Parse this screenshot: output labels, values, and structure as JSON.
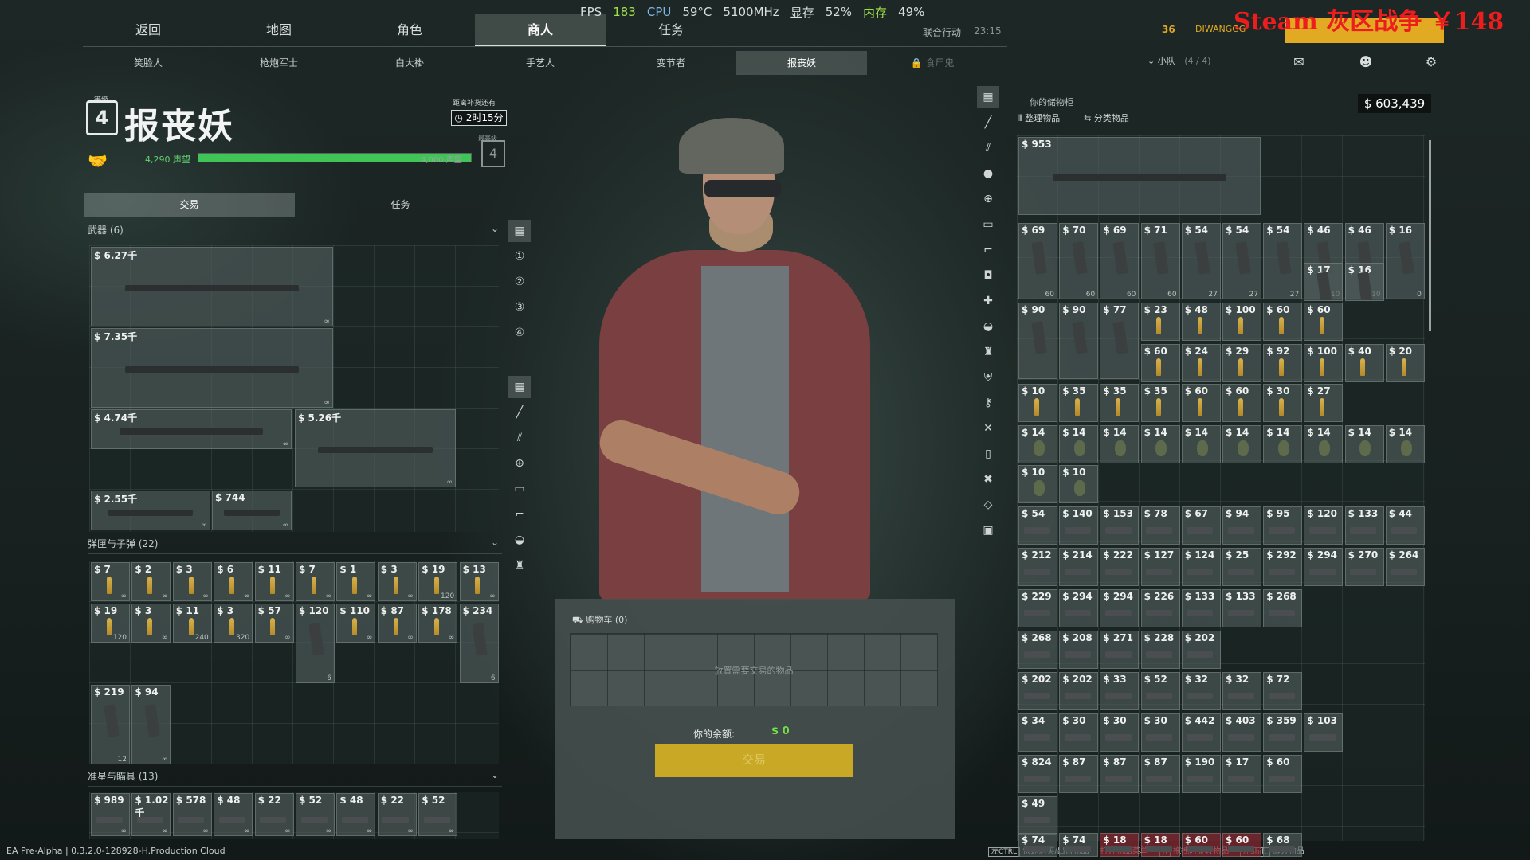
{
  "perf": {
    "fps_label": "FPS",
    "fps": "183",
    "cpu_label": "CPU",
    "cpu_temp": "59°C",
    "cpu_freq": "5100MHz",
    "vram_label": "显存",
    "vram": "52%",
    "ram_label": "内存",
    "ram": "49%"
  },
  "overlay": {
    "steam": "Steam  灰区战争 ￥148",
    "coop": "联合行动",
    "clock": "23:15"
  },
  "player": {
    "level": "36",
    "name": "DIWANGGG"
  },
  "top_nav": [
    {
      "label": "返回"
    },
    {
      "label": "地图"
    },
    {
      "label": "角色"
    },
    {
      "label": "商人",
      "active": true
    },
    {
      "label": "任务"
    }
  ],
  "sub_nav": [
    {
      "label": "笑脸人"
    },
    {
      "label": "枪炮军士"
    },
    {
      "label": "白大褂"
    },
    {
      "label": "手艺人"
    },
    {
      "label": "变节者"
    },
    {
      "label": "报丧妖",
      "active": true
    },
    {
      "label": "食尸鬼",
      "locked": true
    }
  ],
  "squad": {
    "label": "小队",
    "count": "(4 / 4)"
  },
  "trader": {
    "level_label": "等级",
    "level": "4",
    "name": "报丧妖",
    "restock_label": "距离补货还有",
    "restock_time": "2时15分",
    "rep_value": "4,290",
    "rep_label": "声望",
    "rep_max": "4,000 声望",
    "rep_progress": 1.0,
    "max_label": "最高级",
    "max_level": "4"
  },
  "left_tabs": [
    {
      "label": "交易",
      "active": true
    },
    {
      "label": "任务"
    }
  ],
  "sections": {
    "weapons": {
      "title": "武器",
      "count": "(6)"
    },
    "ammo": {
      "title": "弹匣与子弹",
      "count": "(22)"
    },
    "scopes": {
      "title": "准星与瞄具",
      "count": "(13)"
    }
  },
  "weapons": [
    {
      "price": "$ 6.27千",
      "count": "∞"
    },
    {
      "price": "$ 7.35千",
      "count": "∞"
    },
    {
      "price": "$ 4.74千",
      "count": "∞"
    },
    {
      "price": "$ 5.26千",
      "count": "∞"
    },
    {
      "price": "$ 2.55千",
      "count": "∞"
    },
    {
      "price": "$ 744",
      "count": "∞"
    }
  ],
  "ammo_items": [
    {
      "price": "$ 7",
      "count": "∞"
    },
    {
      "price": "$ 2",
      "count": "∞"
    },
    {
      "price": "$ 3",
      "count": "∞"
    },
    {
      "price": "$ 6",
      "count": "∞"
    },
    {
      "price": "$ 11",
      "count": "∞"
    },
    {
      "price": "$ 7",
      "count": "∞"
    },
    {
      "price": "$ 1",
      "count": "∞"
    },
    {
      "price": "$ 3",
      "count": "∞"
    },
    {
      "price": "$ 19",
      "count": "120"
    },
    {
      "price": "$ 13",
      "count": "∞"
    },
    {
      "price": "$ 19",
      "count": "120"
    },
    {
      "price": "$ 3",
      "count": "∞"
    },
    {
      "price": "$ 11",
      "count": "240"
    },
    {
      "price": "$ 3",
      "count": "320"
    },
    {
      "price": "$ 57",
      "count": "∞"
    },
    {
      "price": "$ 120",
      "count": "6"
    },
    {
      "price": "$ 110",
      "count": "∞"
    },
    {
      "price": "$ 87",
      "count": "∞"
    },
    {
      "price": "$ 178",
      "count": "∞"
    },
    {
      "price": "$ 234",
      "count": "6"
    },
    {
      "price": "$ 219",
      "count": "12"
    },
    {
      "price": "$ 94",
      "count": "∞"
    }
  ],
  "scope_items": [
    {
      "price": "$ 989",
      "count": "∞"
    },
    {
      "price": "$ 1.02千",
      "count": "∞"
    },
    {
      "price": "$ 578",
      "count": "∞"
    },
    {
      "price": "$ 48",
      "count": "∞"
    },
    {
      "price": "$ 22",
      "count": "∞"
    },
    {
      "price": "$ 52",
      "count": "∞"
    },
    {
      "price": "$ 48",
      "count": "∞"
    },
    {
      "price": "$ 22",
      "count": "∞"
    },
    {
      "price": "$ 52",
      "count": "∞"
    }
  ],
  "cart": {
    "title": "购物车",
    "count": "(0)",
    "placeholder": "放置需要交易的物品",
    "balance_label": "你的余额:",
    "balance": "$ 0",
    "trade_label": "交易"
  },
  "stash": {
    "title": "你的储物柜",
    "money": "$ 603,439",
    "organize": "整理物品",
    "sort": "分类物品",
    "rows": [
      [
        "$ 69",
        "$ 70",
        "$ 69",
        "$ 71",
        "$ 54",
        "$ 54",
        "$ 54",
        "$ 46",
        "$ 46",
        "$ 16"
      ],
      [
        "$ 17",
        "$ 16"
      ],
      [
        "$ 90",
        "$ 90",
        "$ 77",
        "$ 23",
        "$ 48",
        "$ 100",
        "$ 60",
        "$ 60"
      ],
      [
        "$ 60",
        "$ 24",
        "$ 29",
        "$ 92",
        "$ 100",
        "$ 40",
        "$ 20"
      ],
      [
        "$ 10",
        "$ 35",
        "$ 35",
        "$ 35",
        "$ 60",
        "$ 60",
        "$ 30",
        "$ 27"
      ],
      [
        "$ 14",
        "$ 14",
        "$ 14",
        "$ 14",
        "$ 14",
        "$ 14",
        "$ 14",
        "$ 14",
        "$ 14",
        "$ 14"
      ],
      [
        "$ 10",
        "$ 10"
      ],
      [
        "$ 54",
        "$ 140",
        "$ 153",
        "$ 78",
        "$ 67",
        "$ 94",
        "$ 95",
        "$ 120",
        "$ 133",
        "$ 44"
      ],
      [
        "$ 212",
        "$ 214",
        "$ 222",
        "$ 127",
        "$ 124",
        "$ 25",
        "$ 292",
        "$ 294",
        "$ 270",
        "$ 264"
      ],
      [
        "$ 229",
        "$ 294",
        "$ 294",
        "$ 226",
        "$ 133",
        "$ 133",
        "$ 268"
      ],
      [
        "$ 268",
        "$ 208",
        "$ 271",
        "$ 228",
        "$ 202"
      ],
      [
        "$ 202",
        "$ 202",
        "$ 33",
        "$ 52",
        "$ 32",
        "$ 32",
        "$ 72"
      ],
      [
        "$ 34",
        "$ 30",
        "$ 30",
        "$ 30",
        "$ 442",
        "$ 403",
        "$ 359",
        "$ 103"
      ],
      [
        "$ 824",
        "$ 87",
        "$ 87",
        "$ 87",
        "$ 190",
        "$ 17",
        "$ 60"
      ],
      [
        "$ 49"
      ],
      [
        "$ 74",
        "$ 74",
        "$ 18",
        "$ 18",
        "$ 60",
        "$ 60",
        "$ 68"
      ]
    ],
    "mag_counts": [
      "60",
      "60",
      "60",
      "60",
      "27",
      "27",
      "27",
      "10",
      "10",
      "0"
    ],
    "featured_price": "$ 953"
  },
  "footer": {
    "version": "EA Pre-Alpha | 0.3.2.0-128928-H.Production Cloud",
    "hints": [
      {
        "key": "左CTRL",
        "label": "快速购买/出售物品"
      },
      {
        "key": "",
        "label": "打开物品菜单"
      },
      {
        "key": "R",
        "label": "拖拽时旋转物品"
      },
      {
        "key": "左Shift",
        "label": "拆分物品"
      }
    ]
  },
  "icons": {
    "handshake": "handshake-icon",
    "timer": "clock-icon",
    "chat": "chat-icon",
    "friends": "friends-icon",
    "settings": "gear-icon"
  },
  "colors": {
    "accent_gold": "#e2aa23",
    "rep_green": "#40c455",
    "balance_green": "#74e04a",
    "steam_red": "#ee1d1d"
  }
}
